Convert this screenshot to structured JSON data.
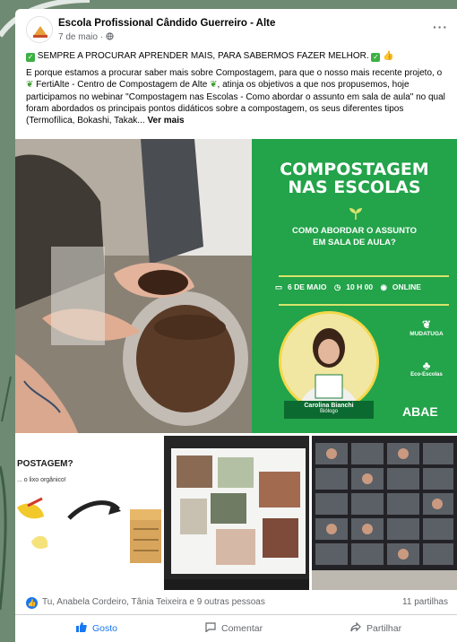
{
  "post": {
    "page_name": "Escola Profissional Cândido Guerreiro - Alte",
    "date": "7 de maio",
    "privacy_icon": "globe-icon",
    "more_icon": "ellipsis-icon",
    "headline": "SEMPRE A PROCURAR APRENDER MAIS, PARA SABERMOS FAZER MELHOR.",
    "body_part1": "E porque estamos a procurar saber mais sobre Compostagem, para que o nosso mais recente projeto, o ",
    "body_part2": " FertiAlte - Centro de Compostagem de Alte ",
    "body_part3": ", atinja os objetivos a que nos propusemos, hoje participamos no webinar \"Compostagem nas Escolas - Como abordar o assunto em sala de aula\" no qual foram abordados os principais pontos didáticos sobre a compostagem, os seus diferentes tipos (Termofílica, Bokashi, Takak...",
    "see_more": "Ver mais"
  },
  "banner": {
    "title_line1": "COMPOSTAGEM",
    "title_line2": "NAS ESCOLAS",
    "subtitle_line1": "COMO ABORDAR O ASSUNTO",
    "subtitle_line2": "EM SALA DE AULA?",
    "date": "6 DE MAIO",
    "time": "10 H 00",
    "mode": "ONLINE",
    "speaker_name": "Carolina Bianchi",
    "speaker_role": "Biólogo",
    "logo1": "MUDATUGA",
    "logo2": "Eco-Escolas",
    "logo3": "ABAE"
  },
  "thumb1": {
    "title": "POSTAGEM?",
    "caption": "... o lixo orgânico!"
  },
  "stats": {
    "reactors": "Tu, Anabela Cordeiro, Tânia Teixeira e 9 outras pessoas",
    "shares": "11 partilhas"
  },
  "actions": {
    "like": "Gosto",
    "comment": "Comentar",
    "share": "Partilhar"
  },
  "colors": {
    "banner_green": "#23a34a",
    "facebook_blue": "#1877f2",
    "muted_text": "#65676b"
  }
}
